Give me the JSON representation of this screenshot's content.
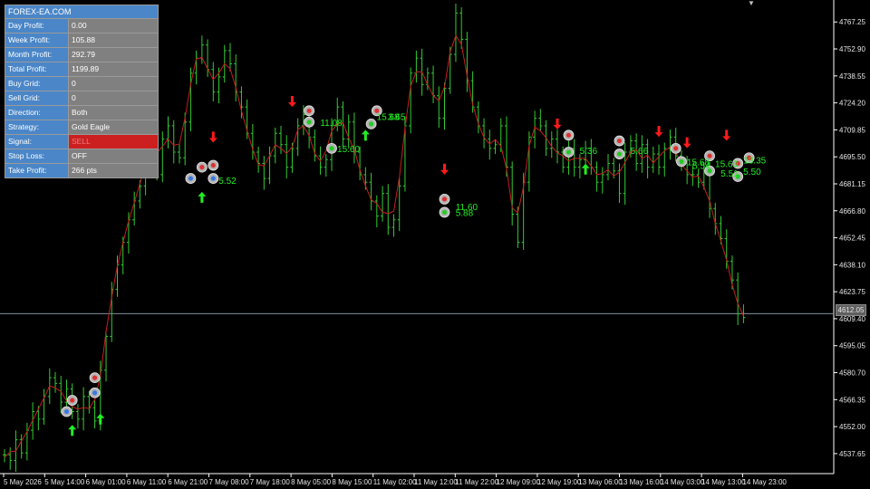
{
  "panel": {
    "title": "FOREX-EA.COM",
    "rows": [
      {
        "label": "Day Profit:",
        "value": "0.00"
      },
      {
        "label": "Week Profit:",
        "value": "105.88"
      },
      {
        "label": "Month Profit:",
        "value": "292.79"
      },
      {
        "label": "Total Profit:",
        "value": "1199.89"
      },
      {
        "label": "Buy Grid:",
        "value": "0"
      },
      {
        "label": "Sell Grid:",
        "value": "0"
      },
      {
        "label": "Direction:",
        "value": "Both"
      },
      {
        "label": "Strategy:",
        "value": "Gold Eagle"
      },
      {
        "label": "Signal:",
        "value": "SELL"
      },
      {
        "label": "Stop Loss:",
        "value": "OFF"
      },
      {
        "label": "Take Profit:",
        "value": "266 pts"
      }
    ]
  },
  "current_price": "4612.05",
  "colors": {
    "background": "#000000",
    "candle_green": "#33cc33",
    "ma_red": "#c81e1e",
    "buy_arrow": "#22ee22",
    "sell_arrow": "#ff1a1a",
    "profit_text": "#22ee22",
    "axis": "#ffffff",
    "price_line": "#7f8fa0"
  },
  "chart_data": {
    "type": "line",
    "ylim": [
      4527,
      4777
    ],
    "y_ticks": [
      "4767.25",
      "4752.90",
      "4738.55",
      "4724.20",
      "4709.85",
      "4695.50",
      "4681.15",
      "4666.80",
      "4652.45",
      "4638.10",
      "4623.75",
      "4609.40",
      "4595.05",
      "4580.70",
      "4566.35",
      "4552.00",
      "4537.65"
    ],
    "x_ticks": [
      "5 May 2026",
      "5 May 14:00",
      "6 May 01:00",
      "6 May 11:00",
      "6 May 21:00",
      "7 May 08:00",
      "7 May 18:00",
      "8 May 05:00",
      "8 May 15:00",
      "11 May 02:00",
      "11 May 12:00",
      "11 May 22:00",
      "12 May 09:00",
      "12 May 19:00",
      "13 May 06:00",
      "13 May 16:00",
      "14 May 03:00",
      "14 May 13:00",
      "14 May 23:00"
    ],
    "closes": [
      4537,
      4534,
      4545,
      4538,
      4550,
      4560,
      4556,
      4568,
      4578,
      4575,
      4565,
      4572,
      4560,
      4556,
      4568,
      4562,
      4555,
      4582,
      4600,
      4625,
      4638,
      4650,
      4662,
      4672,
      4680,
      4692,
      4702,
      4686,
      4705,
      4712,
      4698,
      4695,
      4714,
      4740,
      4748,
      4755,
      4742,
      4730,
      4738,
      4752,
      4745,
      4730,
      4722,
      4708,
      4698,
      4692,
      4684,
      4696,
      4708,
      4702,
      4690,
      4700,
      4712,
      4718,
      4706,
      4696,
      4690,
      4694,
      4712,
      4722,
      4705,
      4714,
      4698,
      4686,
      4682,
      4672,
      4664,
      4676,
      4658,
      4662,
      4680,
      4712,
      4740,
      4748,
      4734,
      4740,
      4728,
      4716,
      4732,
      4750,
      4772,
      4758,
      4736,
      4722,
      4712,
      4705,
      4700,
      4702,
      4712,
      4690,
      4665,
      4650,
      4682,
      4706,
      4716,
      4712,
      4700,
      4705,
      4698,
      4690,
      4700,
      4690,
      4694,
      4700,
      4690,
      4682,
      4686,
      4692,
      4688,
      4676,
      4698,
      4704,
      4692,
      4702,
      4690,
      4697,
      4690,
      4700,
      4706,
      4696,
      4692,
      4686,
      4686,
      4682,
      4688,
      4668,
      4660,
      4652,
      4640,
      4630,
      4612,
      4610
    ],
    "up_arrows": [
      {
        "i": 12,
        "y": 4550
      },
      {
        "i": 17,
        "y": 4556
      },
      {
        "i": 35,
        "y": 4674
      },
      {
        "i": 64,
        "y": 4707
      },
      {
        "i": 103,
        "y": 4689
      }
    ],
    "down_arrows": [
      {
        "i": 37,
        "y": 4706
      },
      {
        "i": 51,
        "y": 4725
      },
      {
        "i": 78,
        "y": 4689
      },
      {
        "i": 98,
        "y": 4713
      },
      {
        "i": 116,
        "y": 4709
      },
      {
        "i": 121,
        "y": 4703
      },
      {
        "i": 128,
        "y": 4707
      }
    ],
    "markers": [
      {
        "i": 11,
        "y": 4560,
        "kind": "buy"
      },
      {
        "i": 12,
        "y": 4566,
        "kind": "sell"
      },
      {
        "i": 16,
        "y": 4570,
        "kind": "buy"
      },
      {
        "i": 16,
        "y": 4578,
        "kind": "sell"
      },
      {
        "i": 33,
        "y": 4684,
        "kind": "buy"
      },
      {
        "i": 35,
        "y": 4690,
        "kind": "sell"
      },
      {
        "i": 37,
        "y": 4684,
        "kind": "buy"
      },
      {
        "i": 37,
        "y": 4691,
        "kind": "sell"
      },
      {
        "i": 54,
        "y": 4714,
        "kind": "close"
      },
      {
        "i": 54,
        "y": 4720,
        "kind": "sell"
      },
      {
        "i": 58,
        "y": 4700,
        "kind": "close"
      },
      {
        "i": 65,
        "y": 4713,
        "kind": "close"
      },
      {
        "i": 66,
        "y": 4720,
        "kind": "sell"
      },
      {
        "i": 78,
        "y": 4673,
        "kind": "sell"
      },
      {
        "i": 78,
        "y": 4666,
        "kind": "close"
      },
      {
        "i": 100,
        "y": 4707,
        "kind": "sell"
      },
      {
        "i": 100,
        "y": 4698,
        "kind": "close"
      },
      {
        "i": 109,
        "y": 4704,
        "kind": "sell"
      },
      {
        "i": 109,
        "y": 4697,
        "kind": "close"
      },
      {
        "i": 119,
        "y": 4700,
        "kind": "sell"
      },
      {
        "i": 120,
        "y": 4693,
        "kind": "close"
      },
      {
        "i": 125,
        "y": 4696,
        "kind": "sell"
      },
      {
        "i": 125,
        "y": 4688,
        "kind": "close"
      },
      {
        "i": 130,
        "y": 4692,
        "kind": "sell"
      },
      {
        "i": 130,
        "y": 4685,
        "kind": "close"
      },
      {
        "i": 132,
        "y": 4695,
        "kind": "sell"
      }
    ],
    "profit_labels": [
      {
        "i": 37,
        "y": 4683,
        "text": "5.52"
      },
      {
        "i": 55,
        "y": 4714,
        "text": "11.08"
      },
      {
        "i": 58,
        "y": 4700,
        "text": "15.60"
      },
      {
        "i": 65,
        "y": 4717,
        "text": "15.68"
      },
      {
        "i": 67,
        "y": 4717,
        "text": "3.65"
      },
      {
        "i": 79,
        "y": 4669,
        "text": "11.60"
      },
      {
        "i": 79,
        "y": 4666,
        "text": "5.88"
      },
      {
        "i": 101,
        "y": 4699,
        "text": "5.36"
      },
      {
        "i": 110,
        "y": 4699,
        "text": "5.66"
      },
      {
        "i": 120,
        "y": 4693,
        "text": "15.68"
      },
      {
        "i": 121,
        "y": 4691,
        "text": "5.54"
      },
      {
        "i": 125,
        "y": 4692,
        "text": "15.60"
      },
      {
        "i": 126,
        "y": 4687,
        "text": "5.51"
      },
      {
        "i": 130,
        "y": 4694,
        "text": "13.35"
      },
      {
        "i": 130,
        "y": 4688,
        "text": "5.50"
      }
    ]
  }
}
